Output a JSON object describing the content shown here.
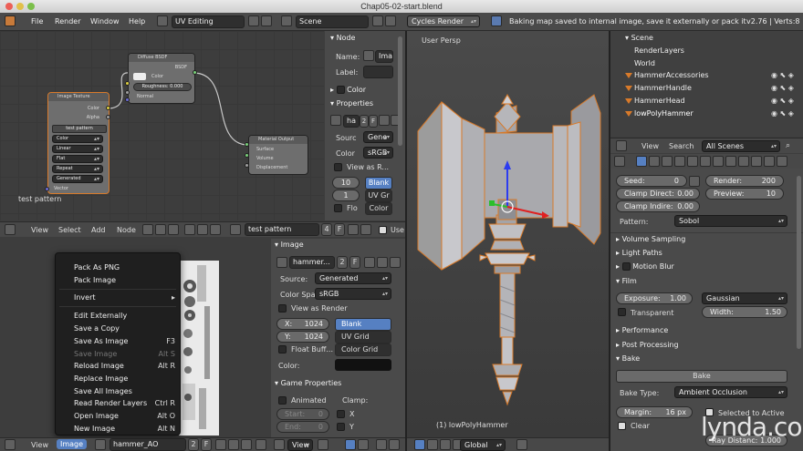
{
  "window": {
    "title": "Chap05-02-start.blend"
  },
  "topbar": {
    "menus": [
      "File",
      "Render",
      "Window",
      "Help"
    ],
    "screen_layout": "UV Editing",
    "scene": "Scene",
    "engine": "Cycles Render",
    "status": "Baking map saved to internal image, save it externally or pack it",
    "version": "v2.76 | Verts:8"
  },
  "node_editor": {
    "nodes": {
      "diffuse": {
        "title": "Diffuse BSDF",
        "out": "BSDF",
        "color": "Color",
        "roughness": "Roughness: 0.000",
        "normal": "Normal"
      },
      "image_texture": {
        "title": "Image Texture",
        "out_color": "Color",
        "out_alpha": "Alpha",
        "image": "test pattern",
        "opts": [
          "Color",
          "Linear",
          "Flat",
          "Repeat",
          "Generated"
        ],
        "vector": "Vector"
      },
      "output": {
        "title": "Material Output",
        "surface": "Surface",
        "volume": "Volume",
        "displacement": "Displacement"
      }
    },
    "frame_label": "test pattern",
    "header": {
      "view": "View",
      "select": "Select",
      "add": "Add",
      "node": "Node",
      "image_name": "test pattern",
      "users": "4",
      "fake": "F",
      "use": "Use"
    }
  },
  "node_sidebar": {
    "node_section": "Node",
    "name_label": "Name:",
    "name_value": "Ima",
    "label_label": "Label:",
    "color_section": "Color",
    "props_section": "Properties",
    "img_name": "ha",
    "img_users": "2",
    "img_fake": "F",
    "source_label": "Sourc",
    "source_value": "Gene",
    "colorsp_label": "Color",
    "colorsp_value": "sRGB",
    "view_as_render": "View as R...",
    "width": "10",
    "height": "1",
    "blank": "Blank",
    "uv_grid": "UV Gr",
    "color_grid": "Color",
    "float": "Flo"
  },
  "image_editor": {
    "context_menu": [
      {
        "label": "Pack As PNG",
        "key": "",
        "disabled": false
      },
      {
        "label": "Pack Image",
        "key": "",
        "disabled": false
      },
      {
        "label": "Invert",
        "key": "",
        "disabled": false
      },
      {
        "label": "Edit Externally",
        "key": "",
        "disabled": false
      },
      {
        "label": "Save a Copy",
        "key": "",
        "disabled": false
      },
      {
        "label": "Save As Image",
        "key": "F3",
        "disabled": false
      },
      {
        "label": "Save Image",
        "key": "Alt S",
        "disabled": true
      },
      {
        "label": "Reload Image",
        "key": "Alt R",
        "disabled": false
      },
      {
        "label": "Replace Image",
        "key": "",
        "disabled": false
      },
      {
        "label": "Save All Images",
        "key": "",
        "disabled": false
      },
      {
        "label": "Read Render Layers",
        "key": "Ctrl R",
        "disabled": false
      },
      {
        "label": "Open Image",
        "key": "Alt O",
        "disabled": false
      },
      {
        "label": "New Image",
        "key": "Alt N",
        "disabled": false
      }
    ],
    "header": {
      "view": "View",
      "image": "Image",
      "image_name": "hammer_AO",
      "users": "2",
      "fake": "F",
      "view2": "View"
    }
  },
  "image_props": {
    "image_section": "Image",
    "img_name": "hammer...",
    "img_users": "2",
    "img_fake": "F",
    "source_label": "Source:",
    "source_value": "Generated",
    "colorsp_label": "Color Spa",
    "colorsp_value": "sRGB",
    "view_as_render": "View as Render",
    "x_label": "X:",
    "x_value": "1024",
    "y_label": "Y:",
    "y_value": "1024",
    "blank": "Blank",
    "uv_grid": "UV Grid",
    "color_grid": "Color Grid",
    "float_buffer": "Float Buff...",
    "color_label": "Color:",
    "game_props": "Game Properties",
    "animated": "Animated",
    "clamp": "Clamp:",
    "start": "Start:",
    "start_val": "0",
    "end": "End:",
    "end_val": "0",
    "clamp_x": "X",
    "clamp_y": "Y"
  },
  "viewport": {
    "label": "User Persp",
    "object": "(1) lowPolyHammer",
    "header": {
      "transform": "Global"
    }
  },
  "outliner": {
    "items": [
      {
        "label": "Scene",
        "indent": 0
      },
      {
        "label": "RenderLayers",
        "indent": 1
      },
      {
        "label": "World",
        "indent": 1
      },
      {
        "label": "HammerAccessories",
        "indent": 1
      },
      {
        "label": "HammerHandle",
        "indent": 1
      },
      {
        "label": "HammerHead",
        "indent": 1
      },
      {
        "label": "lowPolyHammer",
        "indent": 1
      }
    ],
    "header": {
      "view": "View",
      "search": "Search",
      "filter": "All Scenes"
    }
  },
  "render_props": {
    "seed_label": "Seed:",
    "seed_value": "0",
    "render_label": "Render:",
    "render_value": "200",
    "clamp_direct_label": "Clamp Direct:",
    "clamp_direct_value": "0.00",
    "preview_label": "Preview:",
    "preview_value": "10",
    "clamp_indirect_label": "Clamp Indire:",
    "clamp_indirect_value": "0.00",
    "pattern_label": "Pattern:",
    "pattern_value": "Sobol",
    "volume_sampling": "Volume Sampling",
    "light_paths": "Light Paths",
    "motion_blur": "Motion Blur",
    "film": "Film",
    "exposure_label": "Exposure:",
    "exposure_value": "1.00",
    "filter": "Gaussian",
    "transparent": "Transparent",
    "width_label": "Width:",
    "width_value": "1.50",
    "performance": "Performance",
    "post_processing": "Post Processing",
    "bake": "Bake",
    "bake_button": "Bake",
    "bake_type_label": "Bake Type:",
    "bake_type_value": "Ambient Occlusion",
    "margin_label": "Margin:",
    "margin_value": "16 px",
    "selected_to_active": "Selected to Active",
    "clear": "Clear",
    "ray_distance_label": "Ray Distanc:",
    "ray_distance_value": "1.000"
  },
  "watermark": "lynda.com",
  "colors": {
    "selection": "#5680c2",
    "accent": "#d87a2a",
    "node_bg": "#6e6e6e"
  }
}
